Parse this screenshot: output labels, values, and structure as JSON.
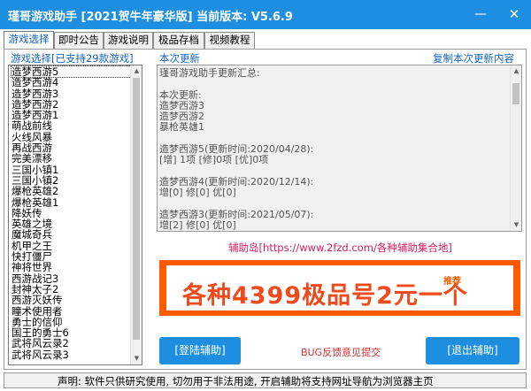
{
  "window": {
    "title": "瑾哥游戏助手 [2021贺牛年豪华版]  当前版本: V5.6.9",
    "minimize_glyph": "—",
    "close_glyph": "✕"
  },
  "tabs": [
    {
      "label": "游戏选择",
      "active": true
    },
    {
      "label": "即时公告",
      "active": false
    },
    {
      "label": "游戏说明",
      "active": false
    },
    {
      "label": "极品存档",
      "active": false
    },
    {
      "label": "视频教程",
      "active": false
    }
  ],
  "game_list": {
    "caption": "游戏选择[已支持29款游戏]",
    "items": [
      "造梦西游5",
      "造梦西游4",
      "造梦西游3",
      "造梦西游2",
      "造梦西游1",
      "萌战前线",
      "火线风暴",
      "再战西游",
      "完美漂移",
      "三国小镇1",
      "三国小镇2",
      "爆枪英雄2",
      "爆枪英雄1",
      "降妖传",
      "英雄之境",
      "魔城奇兵",
      "机甲之王",
      "快打僵尸",
      "神将世界",
      "西游战记3",
      "封神太子2",
      "西游灭妖传",
      "瞳术使用者",
      "勇士的信仰",
      "国王的勇士6",
      "武将风云录2",
      "武将风云录3"
    ]
  },
  "update": {
    "caption": "本次更新",
    "copy_link": "复制本次更新内容",
    "lines": [
      "瑾哥游戏助手更新汇总:",
      "",
      "本次更新:",
      "造梦西游3",
      "造梦西游2",
      "暴枪英雄1",
      "",
      "造梦西游5(更新时间:2020/04/28):",
      "[增] 1项 [修]0项 [优]0项",
      "",
      "造梦西游4(更新时间:2020/12/14):",
      "增[0] 修[0] 优[0]",
      "",
      "造梦西游3(更新时间:2021/05/07):",
      "增[2] 修[0] 优[0]"
    ]
  },
  "site_link": "辅助岛[https://www.2fzd.com/各种辅助集合地]",
  "banner": {
    "tag": "推荐",
    "text": "各种4399极品号2元一个"
  },
  "buttons": {
    "login": "[登陆辅助]",
    "exit": "[退出辅助]",
    "bug": "BUG反馈意见提交"
  },
  "status_text": "声明: 软件只供研究使用, 切勿用于非法用途, 开启辅助将支持网址导航为浏览器主页",
  "colors": {
    "accent": "#1e8fe0",
    "link_blue": "#1565c0",
    "banner_orange": "#ff5a00",
    "site_link_pink": "#d81b60"
  }
}
